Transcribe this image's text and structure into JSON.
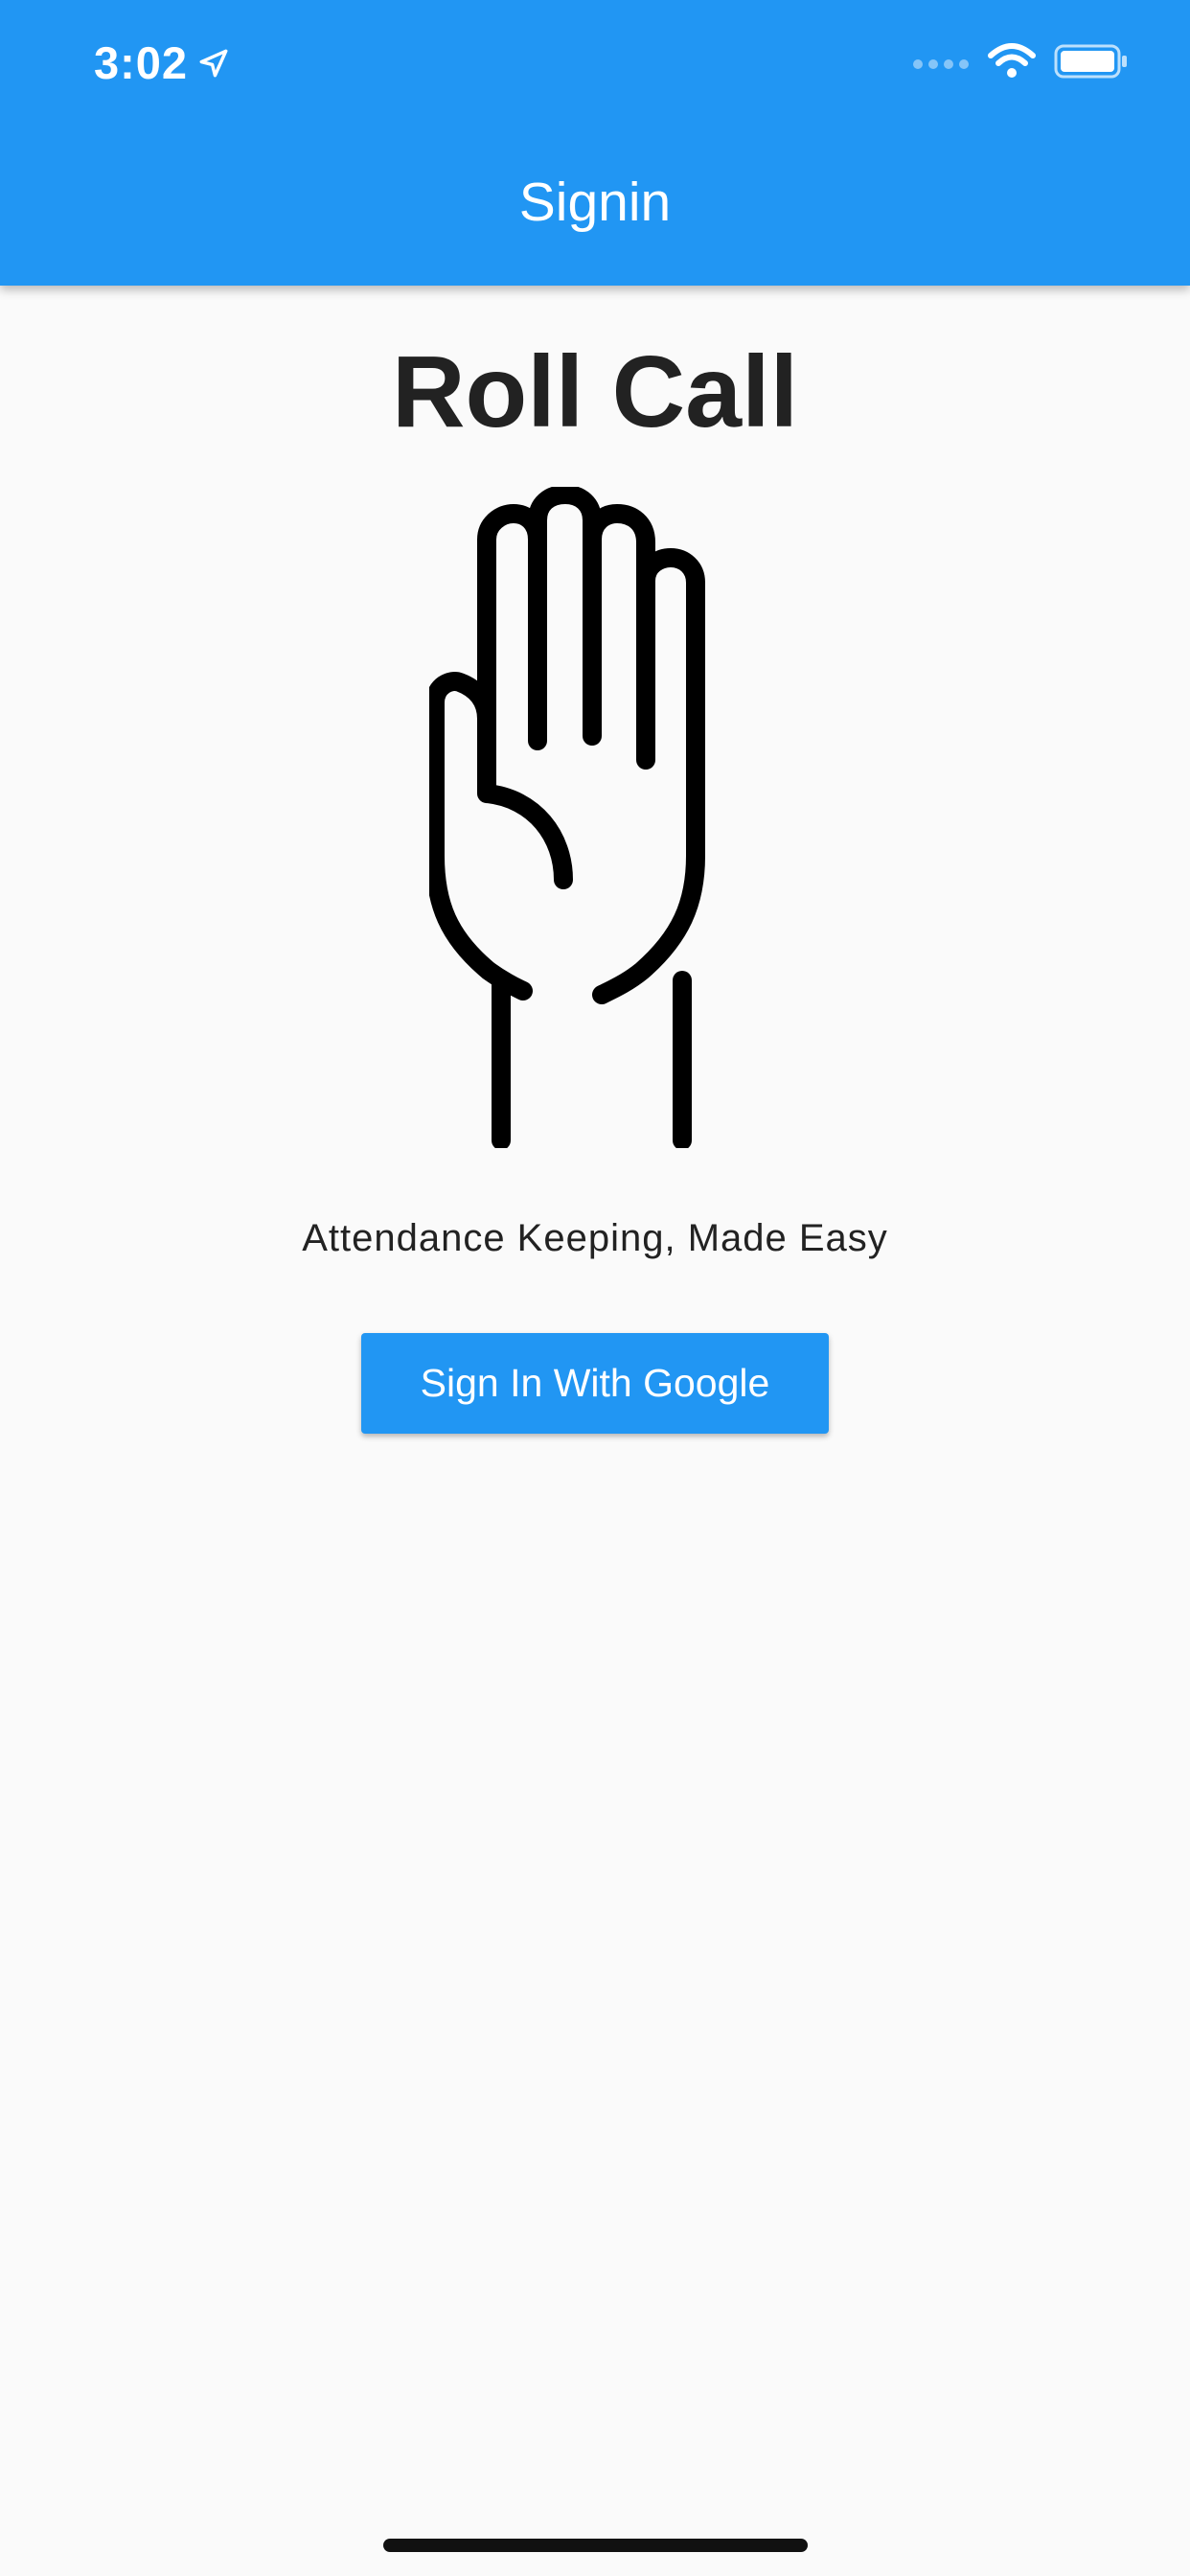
{
  "status_bar": {
    "time": "3:02",
    "location_icon": "location-arrow-icon",
    "signal_icon": "cellular-signal-icon",
    "wifi_icon": "wifi-icon",
    "battery_icon": "battery-icon"
  },
  "app_bar": {
    "title": "Signin",
    "color": "#2196f3"
  },
  "main": {
    "app_name": "Roll Call",
    "logo_icon": "raised-hand-icon",
    "tagline": "Attendance Keeping, Made Easy",
    "sign_in_button_label": "Sign In With Google"
  },
  "colors": {
    "accent": "#2196f3",
    "background": "#fafafa",
    "text": "#222222"
  }
}
